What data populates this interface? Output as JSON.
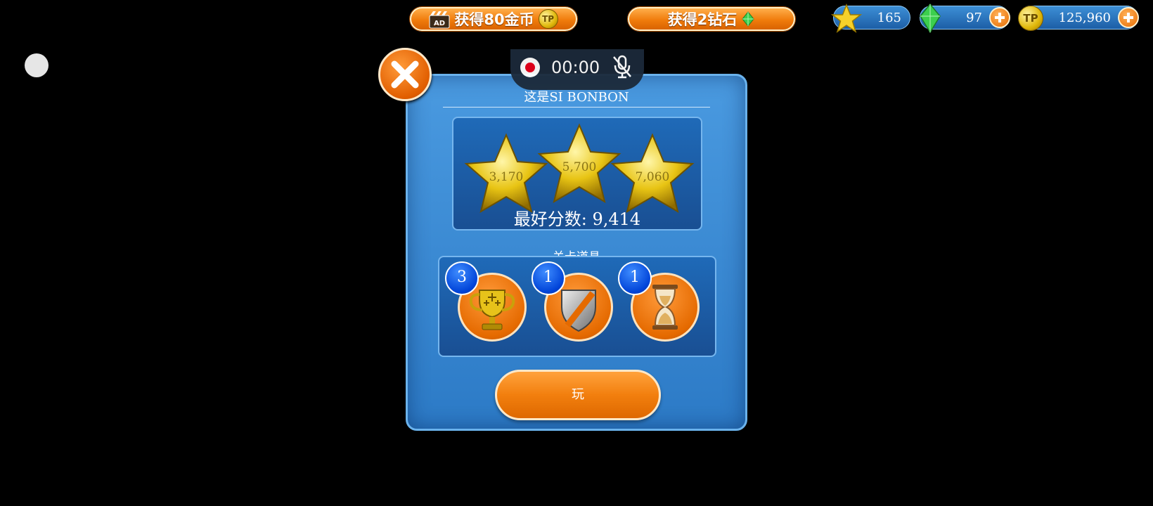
{
  "topbar": {
    "ad_button_label": "获得80金币",
    "diamond_button_label": "获得2钻石",
    "stars_total": "165",
    "gems_total": "97",
    "coins_total": "125,960"
  },
  "recorder": {
    "time": "00:00"
  },
  "dialog": {
    "level_title": "这是SI BONBON",
    "star_thresholds": [
      "3,170",
      "5,700",
      "7,060"
    ],
    "best_score": "最好分数: 9,414",
    "items_heading": "关卡道具",
    "items": [
      {
        "name": "trophy",
        "count": "3"
      },
      {
        "name": "shield",
        "count": "1"
      },
      {
        "name": "hourglass",
        "count": "1"
      }
    ],
    "play_label": "玩"
  },
  "colors": {
    "panel_blue": "#3b8bd6",
    "accent_orange": "#f07c0c",
    "badge_blue": "#0050e0"
  }
}
